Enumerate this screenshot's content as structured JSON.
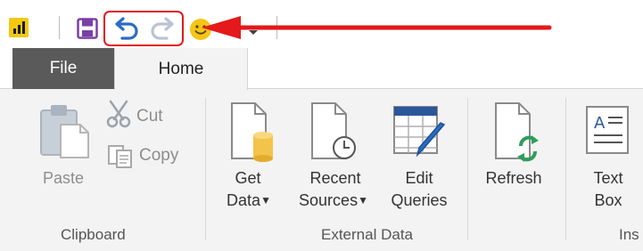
{
  "quick_access": {
    "icons": [
      "power-bi-logo",
      "save-icon",
      "undo-icon",
      "redo-icon",
      "smiley-icon",
      "customize-qat-icon"
    ],
    "highlight_color": "#e3191b"
  },
  "tabs": {
    "file": "File",
    "home": "Home"
  },
  "clipboard": {
    "paste": "Paste",
    "cut": "Cut",
    "copy": "Copy",
    "group_label": "Clipboard"
  },
  "external_data": {
    "get_data_line1": "Get",
    "get_data_line2": "Data",
    "recent_sources_line1": "Recent",
    "recent_sources_line2": "Sources",
    "edit_queries_line1": "Edit",
    "edit_queries_line2": "Queries",
    "group_label": "External Data"
  },
  "refresh": {
    "label": "Refresh"
  },
  "insert": {
    "text_box_line1": "Text",
    "text_box_line2": "Box",
    "group_label_partial": "Ins"
  },
  "colors": {
    "file_tab": "#5a5a5a",
    "ribbon_bg": "#f3f3f3",
    "accent_blue": "#2b579a",
    "annotation_red": "#e3191b"
  }
}
